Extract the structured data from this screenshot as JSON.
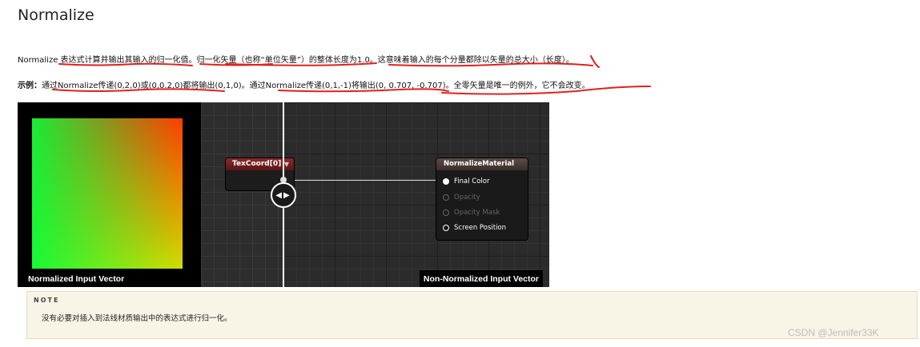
{
  "page": {
    "title": "Normalize",
    "para1": "Normalize 表达式计算并输出其输入的归一化值。归一化矢量（也称“单位矢量”）的整体长度为1.0。这意味着输入的每个分量都除以矢量的总大小（长度）。",
    "para2_label": "示例：",
    "para2_text": "通过Normalize传递(0,2,0)或(0,0.2,0)都将输出(0,1,0)。通过Normalize传递(0,1,-1)将输出(0, 0.707, -0.707)。全零矢量是唯一的例外，它不会改变。"
  },
  "viewer": {
    "left_caption": "Normalized Input Vector",
    "right_caption": "Non-Normalized Input Vector",
    "slider_glyph": "◀▶",
    "texcoord_node": {
      "title": "TexCoord[0]",
      "arrow": "▼"
    },
    "material_node": {
      "title": "NormalizeMaterial",
      "pins": [
        "Final Color",
        "Opacity",
        "Opacity Mask",
        "Screen Position"
      ]
    }
  },
  "note": {
    "label": "NOTE",
    "text": "没有必要对插入到法线材质输出中的表达式进行归一化。"
  },
  "watermark": "CSDN @Jennifer33K",
  "colors": {
    "annotation_red": "#e02020",
    "note_bg": "#f8f4e6"
  }
}
